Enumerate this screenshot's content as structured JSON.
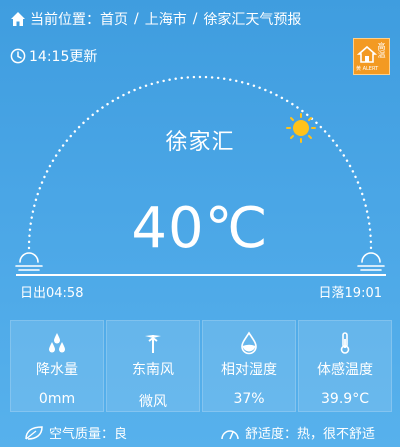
{
  "breadcrumb": {
    "prefix": "当前位置：",
    "items": [
      "首页",
      "上海市",
      "徐家汇天气预报"
    ],
    "separator": "/"
  },
  "update_time": "14:15更新",
  "warning_badge": {
    "text": "高温",
    "sub": "黄 ALERT"
  },
  "location": "徐家汇",
  "temperature": "40℃",
  "sunrise": "日出04:58",
  "sunset": "日落19:01",
  "stats": [
    {
      "icon": "raindrops-icon",
      "label": "降水量",
      "value": "0mm"
    },
    {
      "icon": "wind-vane-icon",
      "label": "东南风",
      "value": "微风"
    },
    {
      "icon": "humidity-drop-icon",
      "label": "相对湿度",
      "value": "37%"
    },
    {
      "icon": "thermometer-icon",
      "label": "体感温度",
      "value": "39.9°C"
    }
  ],
  "air_quality": "空气质量：良",
  "comfort": "舒适度：热，很不舒适",
  "colors": {
    "background": "#4aa6e6",
    "badge": "#f39a22",
    "sun": "#ffc21a",
    "text": "#ffffff"
  }
}
